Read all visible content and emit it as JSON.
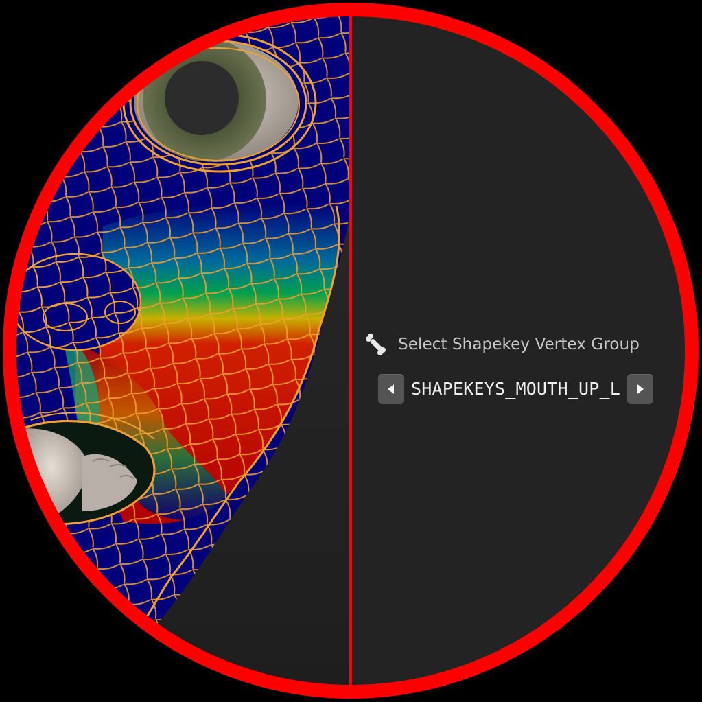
{
  "operator": {
    "icon": "bone-icon",
    "label": "Select Shapekey Vertex Group"
  },
  "vertex_group_selector": {
    "value": "SHAPEKEYS_MOUTH_UP_L",
    "prev_icon": "triangle-left-icon",
    "next_icon": "triangle-right-icon"
  },
  "colors": {
    "magnifier_ring": "#ff0000",
    "panel_bg": "#242424",
    "wireframe": "#f0a030",
    "weight_low": "#00007a",
    "weight_high": "#c80000"
  }
}
